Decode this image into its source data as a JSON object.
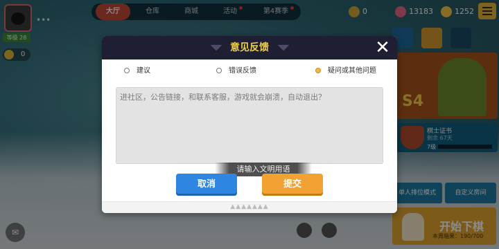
{
  "top_bar": {
    "level_label": "等级 28",
    "emoji_count": "0",
    "more_dots": "•••",
    "tabs": [
      {
        "label": "大厅",
        "active": true
      },
      {
        "label": "仓库",
        "active": false
      },
      {
        "label": "商城",
        "active": false
      },
      {
        "label": "活动",
        "active": false,
        "badge": true
      },
      {
        "label": "第4赛季",
        "active": false,
        "badge": true
      }
    ],
    "currencies": [
      {
        "icon": "coin-icon",
        "value": "0",
        "color": "#d4a63a"
      },
      {
        "icon": "candy-icon",
        "value": "13183",
        "color": "#e86a86"
      },
      {
        "icon": "gem-icon",
        "value": "1252",
        "color": "#f3c64a"
      }
    ]
  },
  "side_panel": {
    "season_label": "S4",
    "pass_title": "棋士证书",
    "pass_remaining": "剩余 67天",
    "pass_level": "7级",
    "pass_progress": 0.0,
    "modes": [
      "单人排位模式",
      "自定义房间"
    ],
    "start_label": "开始下棋",
    "start_sub": "本周箱果：190/700"
  },
  "dialog": {
    "title": "意见反馈",
    "close_glyph": "✕",
    "options": [
      {
        "label": "建议",
        "selected": false
      },
      {
        "label": "错误反馈",
        "selected": false
      },
      {
        "label": "疑问或其他问题",
        "selected": true
      }
    ],
    "feedback_text": "进社区，公告链接，和联系客服，游戏就会崩溃，自动退出？",
    "toast": "请输入文明用语",
    "cancel_label": "取消",
    "submit_label": "提交"
  },
  "colors": {
    "accent_gold": "#f0d04a",
    "cancel_blue": "#2f86e0",
    "submit_orange": "#f1a233",
    "selected_radio": "#f0b84a"
  }
}
